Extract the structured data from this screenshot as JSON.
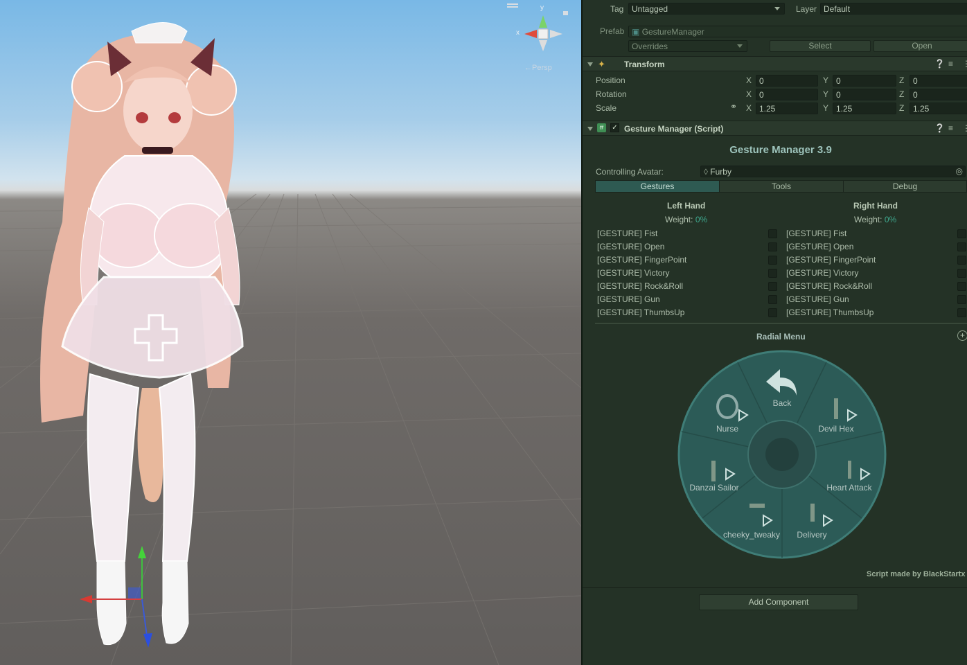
{
  "scene": {
    "gizmo": {
      "x_label": "x",
      "y_label": "y"
    },
    "persp_label": "←Persp"
  },
  "inspector": {
    "tag_label": "Tag",
    "tag_value": "Untagged",
    "layer_label": "Layer",
    "layer_value": "Default",
    "prefab_label": "Prefab",
    "prefab_value": "GestureManager",
    "overrides_label": "Overrides",
    "select_label": "Select",
    "open_label": "Open",
    "transform": {
      "title": "Transform",
      "position_label": "Position",
      "rotation_label": "Rotation",
      "scale_label": "Scale",
      "position": {
        "x": "0",
        "y": "0",
        "z": "0"
      },
      "rotation": {
        "x": "0",
        "y": "0",
        "z": "0"
      },
      "scale": {
        "x": "1.25",
        "y": "1.25",
        "z": "1.25"
      },
      "axis_x": "X",
      "axis_y": "Y",
      "axis_z": "Z"
    },
    "gesture_manager": {
      "header_title": "Gesture Manager (Script)",
      "title": "Gesture Manager 3.9",
      "controlling_avatar_label": "Controlling Avatar:",
      "controlling_avatar_value": "Furby",
      "tabs": [
        "Gestures",
        "Tools",
        "Debug"
      ],
      "active_tab": "Gestures",
      "left_hand": {
        "title": "Left Hand",
        "weight_label": "Weight:",
        "weight_value": "0%"
      },
      "right_hand": {
        "title": "Right Hand",
        "weight_label": "Weight:",
        "weight_value": "0%"
      },
      "gestures": [
        "[GESTURE] Fist",
        "[GESTURE] Open",
        "[GESTURE] FingerPoint",
        "[GESTURE] Victory",
        "[GESTURE] Rock&Roll",
        "[GESTURE] Gun",
        "[GESTURE] ThumbsUp"
      ],
      "radial_menu_title": "Radial Menu",
      "radial_items": [
        "Back",
        "Devil Hex",
        "Heart Attack",
        "Delivery",
        "cheeky_tweaky",
        "Danzai Sailor",
        "Nurse"
      ],
      "credit": "Script made by BlackStartx"
    },
    "add_component_label": "Add Component"
  },
  "colors": {
    "inspector_bg": "#243226",
    "accent_teal": "#2e5a52",
    "weight_teal": "#3ea88e",
    "radial_fill": "#2c5b57"
  }
}
